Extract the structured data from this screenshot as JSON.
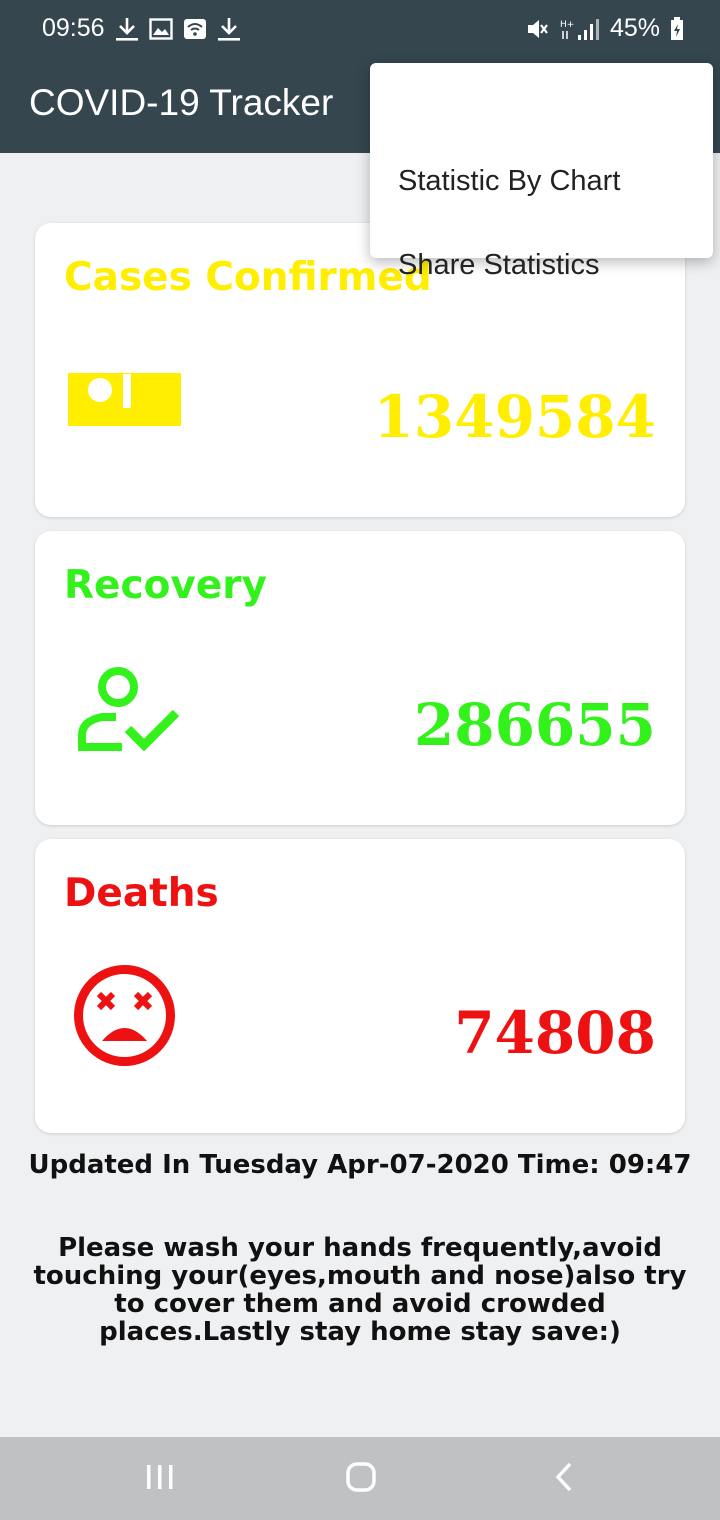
{
  "status_bar": {
    "time": "09:56",
    "battery": "45%",
    "icons": [
      "download-icon",
      "image-icon",
      "wifi-icon",
      "download-icon",
      "mute-icon",
      "signal-icon",
      "battery-icon"
    ]
  },
  "app_bar": {
    "title": "COVID-19 Tracker",
    "color": "#35464f"
  },
  "overflow_menu": {
    "items": [
      {
        "label": "Statistic By Chart"
      },
      {
        "label": "Share Statistics"
      }
    ]
  },
  "cards": [
    {
      "title": "Cases Confirmed",
      "value": "1349584",
      "icon": "bed-icon",
      "color": "#ffee00"
    },
    {
      "title": "Recovery",
      "value": "286655",
      "icon": "person-check-icon",
      "color": "#33f11b"
    },
    {
      "title": "Deaths",
      "value": "74808",
      "icon": "dead-face-icon",
      "color": "#ee1111"
    }
  ],
  "updated_text": "Updated In Tuesday Apr-07-2020 Time: 09:47",
  "message": "Please wash your hands frequently,avoid touching your(eyes,mouth and nose)also try to cover them and avoid crowded places.Lastly stay home stay save:)",
  "nav_bar": {
    "buttons": [
      "recents-icon",
      "home-icon",
      "back-icon"
    ]
  }
}
